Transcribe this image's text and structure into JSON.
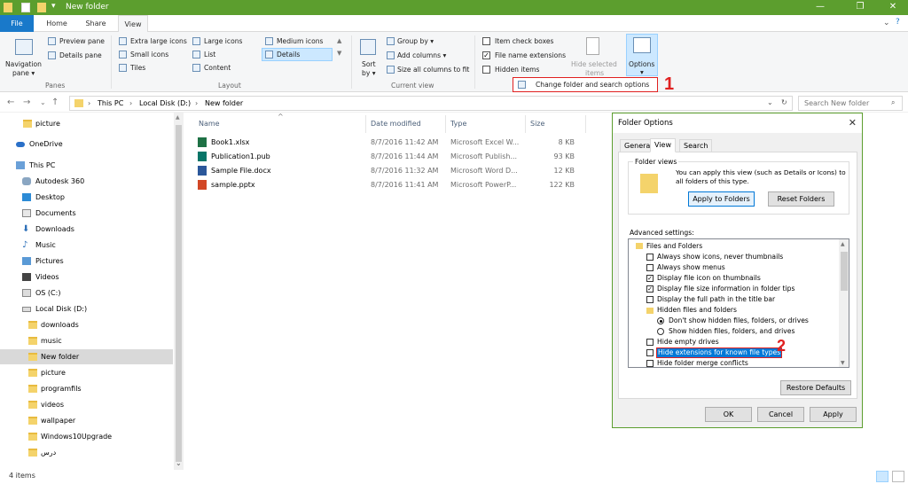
{
  "window": {
    "title": "New folder"
  },
  "tabs": {
    "file": "File",
    "home": "Home",
    "share": "Share",
    "view": "View"
  },
  "ribbon": {
    "panes": {
      "navigation_pane": "Navigation",
      "navigation_pane2": "pane ▾",
      "preview_pane": "Preview pane",
      "details_pane": "Details pane",
      "title": "Panes"
    },
    "layout": {
      "extra_large": "Extra large icons",
      "large": "Large icons",
      "medium": "Medium icons",
      "small": "Small icons",
      "list": "List",
      "details": "Details",
      "tiles": "Tiles",
      "content": "Content",
      "title": "Layout"
    },
    "current_view": {
      "sort_by": "Sort",
      "sort_by2": "by ▾",
      "group_by": "Group by ▾",
      "add_columns": "Add columns ▾",
      "size_all": "Size all columns to fit",
      "title": "Current view"
    },
    "show_hide": {
      "item_checkboxes": "Item check boxes",
      "file_name_ext": "File name extensions",
      "hidden_items": "Hidden items",
      "hide_selected": "Hide selected",
      "hide_selected2": "items",
      "options": "Options",
      "options_arrow": "▾"
    },
    "change_options": "Change folder and search options",
    "callout_1": "1"
  },
  "address": {
    "path": [
      "This PC",
      "Local Disk (D:)",
      "New folder"
    ],
    "search_placeholder": "Search New folder"
  },
  "nav": {
    "items": [
      {
        "label": "picture"
      },
      {
        "label": "OneDrive"
      },
      {
        "label": "This PC"
      },
      {
        "label": "Autodesk 360"
      },
      {
        "label": "Desktop"
      },
      {
        "label": "Documents"
      },
      {
        "label": "Downloads"
      },
      {
        "label": "Music"
      },
      {
        "label": "Pictures"
      },
      {
        "label": "Videos"
      },
      {
        "label": "OS (C:)"
      },
      {
        "label": "Local Disk (D:)"
      },
      {
        "label": "downloads"
      },
      {
        "label": "music"
      },
      {
        "label": "New folder"
      },
      {
        "label": "picture"
      },
      {
        "label": "programfils"
      },
      {
        "label": "videos"
      },
      {
        "label": "wallpaper"
      },
      {
        "label": "Windows10Upgrade"
      },
      {
        "label": "درس"
      }
    ]
  },
  "files": {
    "columns": {
      "name": "Name",
      "date": "Date modified",
      "type": "Type",
      "size": "Size"
    },
    "rows": [
      {
        "name": "Book1.xlsx",
        "date": "8/7/2016 11:42 AM",
        "type": "Microsoft Excel W...",
        "size": "8 KB"
      },
      {
        "name": "Publication1.pub",
        "date": "8/7/2016 11:44 AM",
        "type": "Microsoft Publish...",
        "size": "93 KB"
      },
      {
        "name": "Sample File.docx",
        "date": "8/7/2016 11:32 AM",
        "type": "Microsoft Word D...",
        "size": "12 KB"
      },
      {
        "name": "sample.pptx",
        "date": "8/7/2016 11:41 AM",
        "type": "Microsoft PowerP...",
        "size": "122 KB"
      }
    ]
  },
  "status": {
    "count": "4 items"
  },
  "dialog": {
    "title": "Folder Options",
    "tabs": {
      "general": "General",
      "view": "View",
      "search": "Search"
    },
    "folder_views": {
      "legend": "Folder views",
      "text1": "You can apply this view (such as Details or Icons) to",
      "text2": "all folders of this type.",
      "apply": "Apply to Folders",
      "reset": "Reset Folders"
    },
    "advanced_label": "Advanced settings:",
    "tree": {
      "files_and_folders": "Files and Folders",
      "always_icons": "Always show icons, never thumbnails",
      "always_menus": "Always show menus",
      "display_icon_thumb": "Display file icon on thumbnails",
      "display_size_tips": "Display file size information in folder tips",
      "display_full_path": "Display the full path in the title bar",
      "hidden_files": "Hidden files and folders",
      "dont_show_hidden": "Don't show hidden files, folders, or drives",
      "show_hidden": "Show hidden files, folders, and drives",
      "hide_empty": "Hide empty drives",
      "hide_extensions": "Hide extensions for known file types",
      "hide_merge": "Hide folder merge conflicts"
    },
    "restore": "Restore Defaults",
    "ok": "OK",
    "cancel": "Cancel",
    "apply": "Apply",
    "callout_2": "2"
  }
}
